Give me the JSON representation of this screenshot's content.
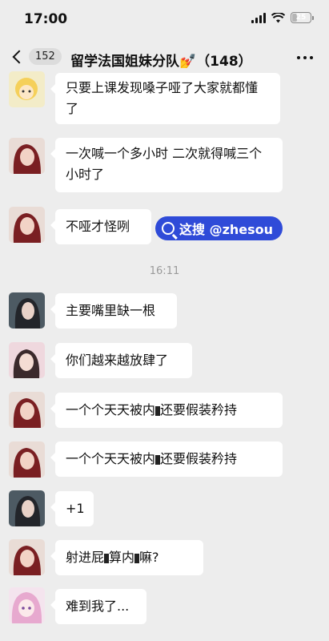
{
  "status_bar": {
    "time": "17:00",
    "battery": "25",
    "battery_level": 0.25
  },
  "nav": {
    "unread_count": "152",
    "title": "留学法国姐妹分队💅（148）"
  },
  "watermark": {
    "text": "这搜 @zhesou"
  },
  "timestamp": "16:11",
  "messages": [
    {
      "avatar": "cartoon-girl-avatar",
      "text": "只要上课发现嗓子哑了大家就都懂了"
    },
    {
      "avatar": "red-hair-girl-avatar",
      "text": "一次喊一个多小时 二次就得喊三个小时了"
    },
    {
      "avatar": "red-hair-girl-avatar",
      "text": "不哑才怪咧"
    },
    {
      "avatar": "dark-hair-girl-avatar",
      "text": "主要嘴里缺一根"
    },
    {
      "avatar": "pink-girl-avatar",
      "text": "你们越来越放肆了"
    },
    {
      "avatar": "red-hair-girl-avatar",
      "text": "一个个天天被内",
      "text_after": "还要假装矜持"
    },
    {
      "avatar": "red-hair-girl-avatar",
      "text": "一个个天天被内",
      "text_after": "还要假装矜持"
    },
    {
      "avatar": "dark-hair-girl-avatar",
      "text": "+1"
    },
    {
      "avatar": "red-hair-girl-avatar",
      "text": "射进屁",
      "text_mid": "算内",
      "text_after": "嘛?"
    },
    {
      "avatar": "anime-pink-avatar",
      "text": "难到我了..."
    }
  ],
  "colors": {
    "background": "#ededed",
    "bubble": "#ffffff",
    "watermark": "#2f4bd8"
  }
}
